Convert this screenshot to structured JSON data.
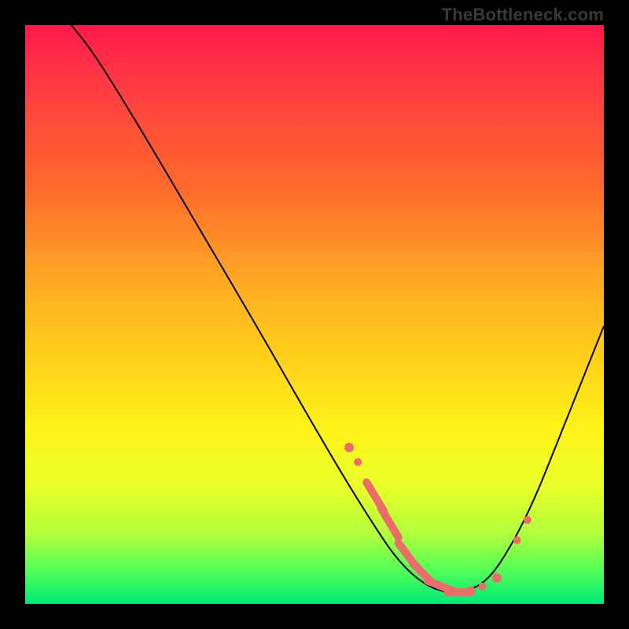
{
  "source_label": "TheBottleneck.com",
  "colors": {
    "marker": "#ee6b6b",
    "curve": "#000000",
    "frame": "#000000"
  },
  "chart_data": {
    "type": "line",
    "title": "",
    "xlabel": "",
    "ylabel": "",
    "xlim": [
      0,
      100
    ],
    "ylim": [
      0,
      100
    ],
    "curve": [
      {
        "x": 8,
        "y": 100
      },
      {
        "x": 12,
        "y": 95
      },
      {
        "x": 20,
        "y": 82
      },
      {
        "x": 30,
        "y": 65
      },
      {
        "x": 40,
        "y": 48
      },
      {
        "x": 48,
        "y": 34
      },
      {
        "x": 55,
        "y": 22
      },
      {
        "x": 60,
        "y": 14
      },
      {
        "x": 64,
        "y": 8
      },
      {
        "x": 68,
        "y": 4
      },
      {
        "x": 72,
        "y": 2
      },
      {
        "x": 76,
        "y": 2
      },
      {
        "x": 80,
        "y": 4
      },
      {
        "x": 84,
        "y": 10
      },
      {
        "x": 88,
        "y": 18
      },
      {
        "x": 92,
        "y": 28
      },
      {
        "x": 96,
        "y": 38
      },
      {
        "x": 100,
        "y": 48
      }
    ],
    "markers": [
      {
        "kind": "dot",
        "x": 56.0,
        "y": 27.0,
        "r": 6
      },
      {
        "kind": "dot",
        "x": 57.5,
        "y": 24.5,
        "r": 5
      },
      {
        "kind": "dash",
        "x1": 59.0,
        "y1": 21.0,
        "x2": 62.0,
        "y2": 16.0
      },
      {
        "kind": "dash",
        "x1": 61.5,
        "y1": 16.5,
        "x2": 64.5,
        "y2": 11.5
      },
      {
        "kind": "dot",
        "x": 63.0,
        "y": 14.0,
        "r": 5
      },
      {
        "kind": "dash",
        "x1": 64.5,
        "y1": 10.5,
        "x2": 67.5,
        "y2": 6.5
      },
      {
        "kind": "dash",
        "x1": 67.0,
        "y1": 7.0,
        "x2": 70.0,
        "y2": 4.0
      },
      {
        "kind": "dash",
        "x1": 69.5,
        "y1": 4.0,
        "x2": 74.5,
        "y2": 2.0
      },
      {
        "kind": "dash",
        "x1": 73.0,
        "y1": 2.0,
        "x2": 77.0,
        "y2": 2.0
      },
      {
        "kind": "dot",
        "x": 77.0,
        "y": 2.2,
        "r": 6
      },
      {
        "kind": "dot",
        "x": 79.0,
        "y": 3.0,
        "r": 5
      },
      {
        "kind": "dot",
        "x": 81.5,
        "y": 4.5,
        "r": 6
      },
      {
        "kind": "dot",
        "x": 85.0,
        "y": 11.0,
        "r": 5
      },
      {
        "kind": "dot",
        "x": 86.8,
        "y": 14.5,
        "r": 5
      }
    ]
  }
}
